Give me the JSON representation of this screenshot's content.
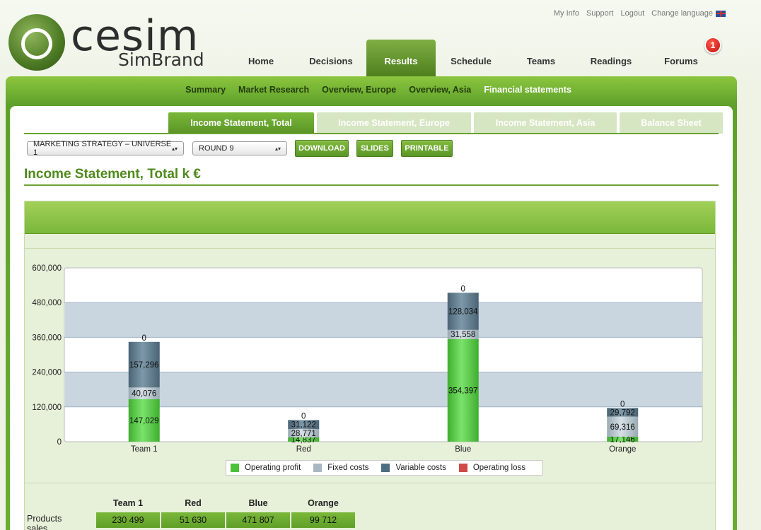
{
  "logo": {
    "word": "cesim",
    "sub": "SimBrand"
  },
  "toplinks": [
    "My Info",
    "Support",
    "Logout",
    "Change language"
  ],
  "mainnav": [
    "Home",
    "Decisions",
    "Results",
    "Schedule",
    "Teams",
    "Readings",
    "Forums"
  ],
  "mainnav_active": "Results",
  "forums_badge": "1",
  "subnav": [
    "Summary",
    "Market Research",
    "Overview, Europe",
    "Overview, Asia",
    "Financial statements"
  ],
  "subnav_active": "Financial statements",
  "tabs": [
    "Income Statement, Total",
    "Income Statement, Europe",
    "Income Statement, Asia",
    "Balance Sheet"
  ],
  "tabs_active": "Income Statement, Total",
  "controls": {
    "strategy": "MARKETING STRATEGY – UNIVERSE 1",
    "round": "ROUND 9",
    "download": "DOWNLOAD",
    "slides": "SLIDES",
    "printable": "PRINTABLE"
  },
  "page_title": "Income Statement, Total k €",
  "colors": {
    "operating_profit": "#5ccf4a",
    "fixed_costs": "#b5c3cc",
    "variable_costs": "#5f7d8f",
    "operating_loss": "#d04a4a"
  },
  "chart_data": {
    "type": "bar",
    "stacked": true,
    "categories": [
      "Team 1",
      "Red",
      "Blue",
      "Orange"
    ],
    "series": [
      {
        "name": "Operating profit",
        "values": [
          147029,
          14837,
          354397,
          17146
        ]
      },
      {
        "name": "Fixed costs",
        "values": [
          40076,
          28771,
          31558,
          69316
        ]
      },
      {
        "name": "Variable costs",
        "values": [
          157296,
          31122,
          128034,
          29792
        ]
      },
      {
        "name": "Operating loss",
        "values": [
          0,
          0,
          0,
          0
        ]
      }
    ],
    "ylim": [
      0,
      600000
    ],
    "yticks": [
      "0",
      "120,000",
      "240,000",
      "360,000",
      "480,000",
      "600,000"
    ],
    "ytick_values": [
      0,
      120000,
      240000,
      360000,
      480000,
      600000
    ],
    "labels": {
      "Operating profit": [
        "147,029",
        "14,837",
        "354,397",
        "17,146"
      ],
      "Fixed costs": [
        "40,076",
        "28,771",
        "31,558",
        "69,316"
      ],
      "Variable costs": [
        "157,296",
        "31,122",
        "128,034",
        "29,792"
      ],
      "Operating loss": [
        "0",
        "0",
        "0",
        "0"
      ]
    },
    "legend_position": "bottom",
    "grid": true
  },
  "table": {
    "headers": [
      "Team 1",
      "Red",
      "Blue",
      "Orange"
    ],
    "rows": [
      {
        "label": "Products sales",
        "values": [
          "230 499",
          "51 630",
          "471 807",
          "99 712"
        ]
      }
    ]
  }
}
